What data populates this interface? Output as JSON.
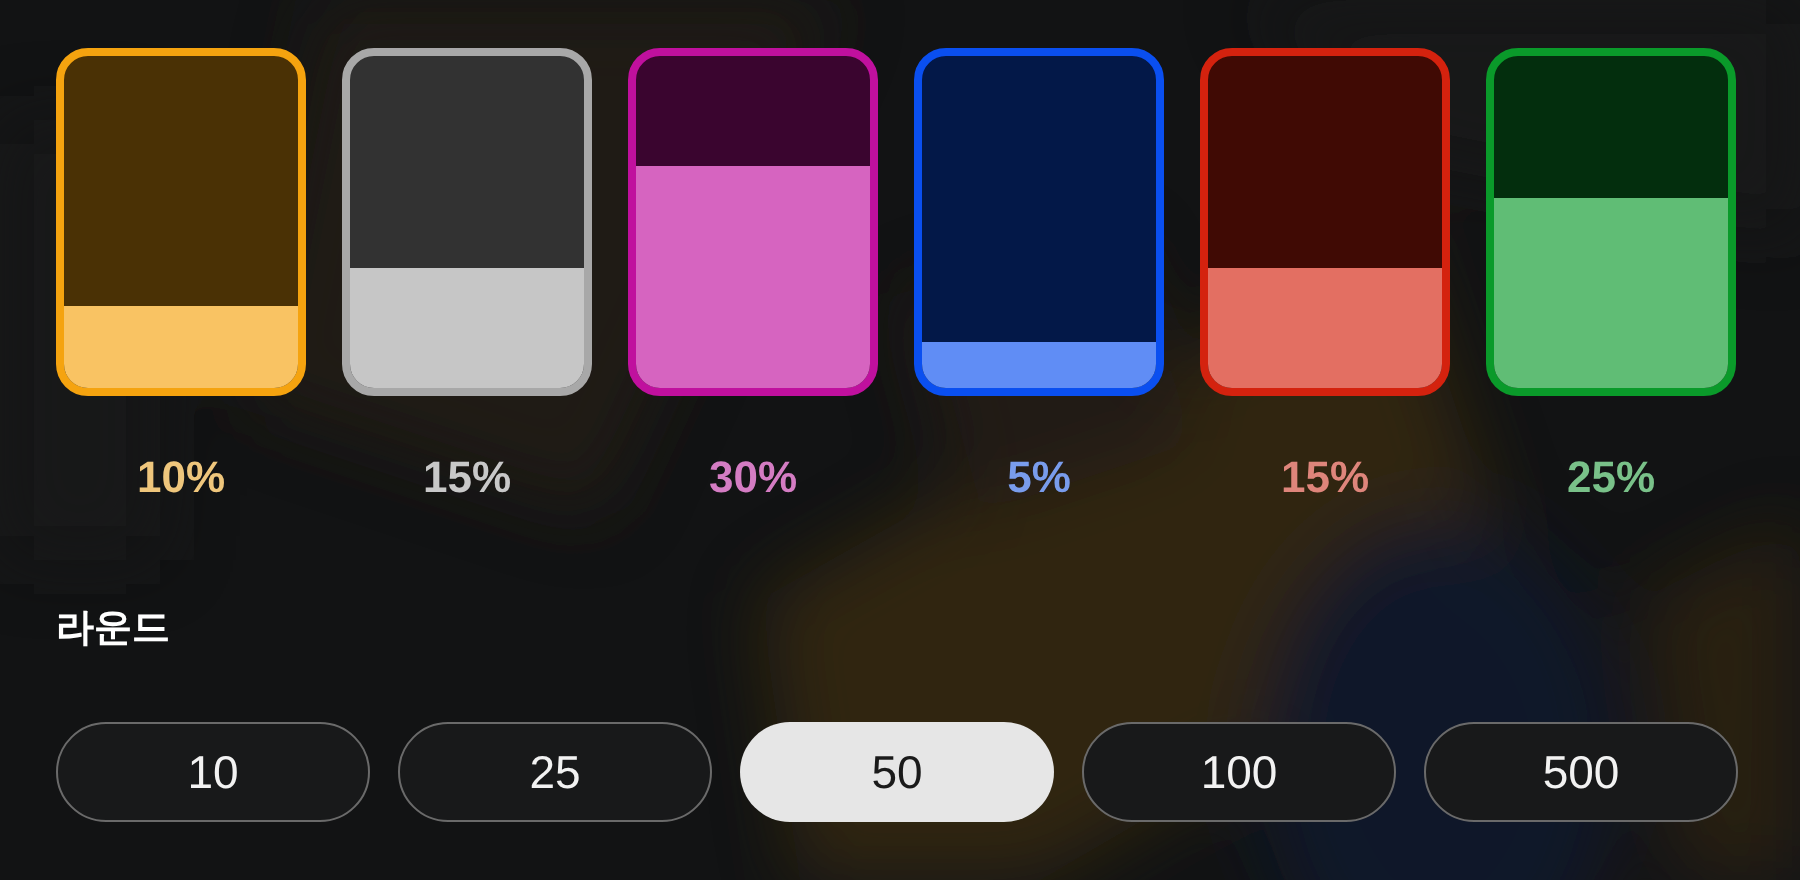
{
  "odds": [
    {
      "color": "#f5a30f",
      "level": 0.25,
      "percent": "10%"
    },
    {
      "color": "#a8a8a8",
      "level": 0.36,
      "percent": "15%"
    },
    {
      "color": "#c0109e",
      "level": 0.67,
      "percent": "30%"
    },
    {
      "color": "#0a4ff0",
      "level": 0.14,
      "percent": "5%"
    },
    {
      "color": "#d4220e",
      "level": 0.36,
      "percent": "15%"
    },
    {
      "color": "#0a9a2a",
      "level": 0.57,
      "percent": "25%"
    }
  ],
  "rounds": {
    "title": "라운드",
    "options": [
      {
        "label": "10",
        "selected": false
      },
      {
        "label": "25",
        "selected": false
      },
      {
        "label": "50",
        "selected": true
      },
      {
        "label": "100",
        "selected": false
      },
      {
        "label": "500",
        "selected": false
      }
    ]
  }
}
